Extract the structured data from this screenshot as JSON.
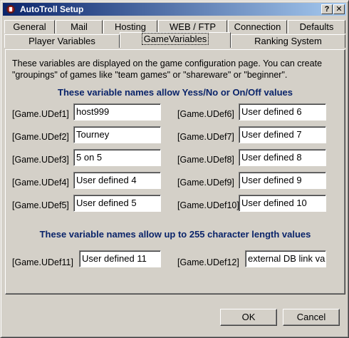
{
  "window": {
    "title": "AutoTroll Setup",
    "help_label": "?",
    "close_label": "✕"
  },
  "tabs_row1": [
    "General",
    "Mail",
    "Hosting",
    "WEB / FTP",
    "Connection",
    "Defaults"
  ],
  "tabs_row2": [
    "Player Variables",
    "GameVariables",
    "Ranking System"
  ],
  "description": "These  variables are displayed on the game configuration page.  You can create \"groupings\" of games like \"team games\" or \"shareware\" or \"beginner\".",
  "heading_bool": "These variable names allow Yess/No or On/Off values",
  "heading_text": "These variable names allow up to 255 character length values",
  "fields": [
    {
      "label": "[Game.UDef1]",
      "value": "host999"
    },
    {
      "label": "[Game.UDef2]",
      "value": "Tourney"
    },
    {
      "label": "[Game.UDef3]",
      "value": "5 on 5"
    },
    {
      "label": "[Game.UDef4]",
      "value": "User defined 4"
    },
    {
      "label": "[Game.UDef5]",
      "value": "User defined 5"
    },
    {
      "label": "[Game.UDef6]",
      "value": "User defined 6"
    },
    {
      "label": "[Game.UDef7]",
      "value": "User defined 7"
    },
    {
      "label": "[Game.UDef8]",
      "value": "User defined 8"
    },
    {
      "label": "[Game.UDef9]",
      "value": "User defined 9"
    },
    {
      "label": "[Game.UDef10]",
      "value": "User defined 10"
    },
    {
      "label": "[Game.UDef11]",
      "value": "User defined 11"
    },
    {
      "label": "[Game.UDef12]",
      "value": "external DB link va"
    }
  ],
  "buttons": {
    "ok": "OK",
    "cancel": "Cancel"
  }
}
